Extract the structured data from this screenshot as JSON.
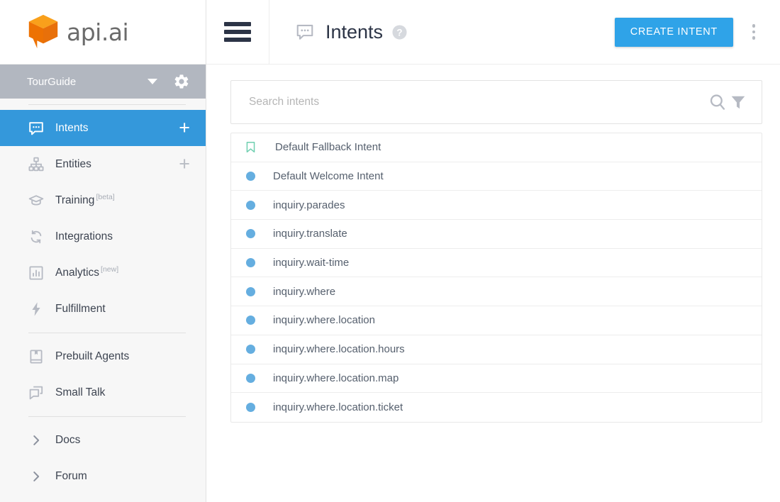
{
  "brand": {
    "name": "api.ai",
    "logo_color": "#f07d00",
    "logo_icon": "cube-speech-bubble-logo"
  },
  "agent": {
    "name": "TourGuide",
    "caret_icon": "chevron-down-icon",
    "settings_icon": "gear-icon"
  },
  "sidebar": {
    "items": [
      {
        "label": "Intents",
        "icon": "chat-bubble-icon",
        "active": true,
        "has_plus": true,
        "sup": ""
      },
      {
        "label": "Entities",
        "icon": "hierarchy-icon",
        "active": false,
        "has_plus": true,
        "sup": ""
      },
      {
        "label": "Training",
        "icon": "graduation-cap-icon",
        "active": false,
        "has_plus": false,
        "sup": "[beta]"
      },
      {
        "label": "Integrations",
        "icon": "sync-arrows-icon",
        "active": false,
        "has_plus": false,
        "sup": ""
      },
      {
        "label": "Analytics",
        "icon": "bar-chart-icon",
        "active": false,
        "has_plus": false,
        "sup": "[new]"
      },
      {
        "label": "Fulfillment",
        "icon": "lightning-bolt-icon",
        "active": false,
        "has_plus": false,
        "sup": ""
      }
    ],
    "items2": [
      {
        "label": "Prebuilt Agents",
        "icon": "book-bookmark-icon"
      },
      {
        "label": "Small Talk",
        "icon": "chat-windows-icon"
      }
    ],
    "items3": [
      {
        "label": "Docs",
        "icon": "chevron-right-icon"
      },
      {
        "label": "Forum",
        "icon": "chevron-right-icon"
      }
    ],
    "plus_label": "+",
    "active_color": "#3498db"
  },
  "topbar": {
    "menu_icon": "hamburger-menu-icon",
    "title_icon": "chat-bubble-icon",
    "title": "Intents",
    "help_icon": "help-circle-icon",
    "create_label": "CREATE INTENT",
    "create_color": "#2fa3e8",
    "kebab_icon": "more-vertical-icon"
  },
  "search": {
    "placeholder": "Search intents",
    "value": "",
    "search_icon": "magnifier-icon",
    "filter_icon": "funnel-filter-icon"
  },
  "intents": [
    {
      "name": "Default Fallback Intent",
      "marker": "bookmark-icon",
      "marker_color": "#6fcfb0"
    },
    {
      "name": "Default Welcome Intent",
      "marker": "dot",
      "marker_color": "#65aee0"
    },
    {
      "name": "inquiry.parades",
      "marker": "dot",
      "marker_color": "#65aee0"
    },
    {
      "name": "inquiry.translate",
      "marker": "dot",
      "marker_color": "#65aee0"
    },
    {
      "name": "inquiry.wait-time",
      "marker": "dot",
      "marker_color": "#65aee0"
    },
    {
      "name": "inquiry.where",
      "marker": "dot",
      "marker_color": "#65aee0"
    },
    {
      "name": "inquiry.where.location",
      "marker": "dot",
      "marker_color": "#65aee0"
    },
    {
      "name": "inquiry.where.location.hours",
      "marker": "dot",
      "marker_color": "#65aee0"
    },
    {
      "name": "inquiry.where.location.map",
      "marker": "dot",
      "marker_color": "#65aee0"
    },
    {
      "name": "inquiry.where.location.ticket",
      "marker": "dot",
      "marker_color": "#65aee0"
    }
  ]
}
